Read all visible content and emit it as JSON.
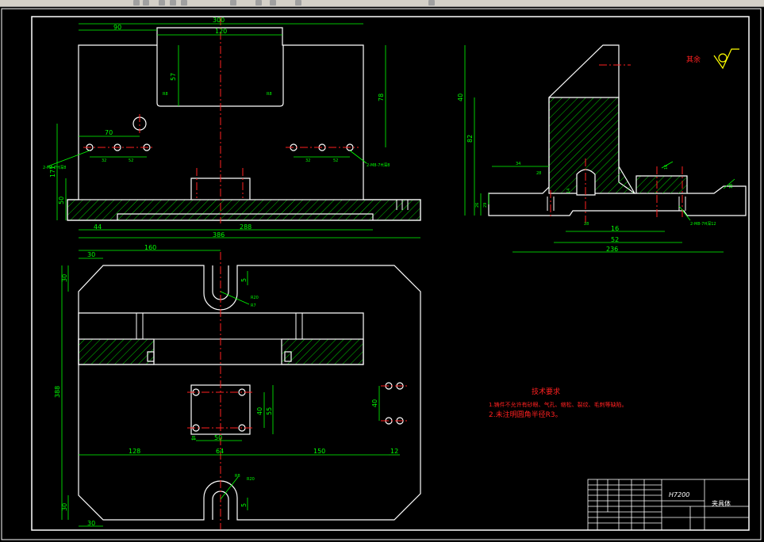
{
  "colors": {
    "background": "#000000",
    "outline": "#ffffff",
    "dimension": "#00ff00",
    "center_line": "#ff2020",
    "hatch": "#00cc00",
    "toolbar": "#d4d0c8"
  },
  "front_view": {
    "dims": {
      "total_top": "300",
      "left_90": "90",
      "slot_120": "120",
      "h57": "57",
      "r_left": "R8",
      "r_right": "R8",
      "v_right": "78",
      "d70": "70",
      "d32a": "32",
      "d52a": "52",
      "d32b": "32",
      "d52b": "52",
      "thread_left": "2-M8-7H深8",
      "thread_right": "2-M8-7H深8",
      "v171": "171",
      "v50": "50",
      "b44": "44",
      "b288": "288",
      "b386": "386"
    }
  },
  "side_view": {
    "dims": {
      "v_left": "40",
      "v_mid": "82",
      "d34": "34",
      "d28": "28",
      "d14": "14",
      "d26": "26",
      "d29": "29",
      "d28b": "28",
      "d16": "16",
      "d16r": "16",
      "d18r": "18",
      "d52": "52",
      "d236": "236",
      "thread": "2-M8-7H深12"
    }
  },
  "top_view": {
    "dims": {
      "t30": "30",
      "t160": "160",
      "v30a": "30",
      "v388": "388",
      "v30b": "30",
      "b30": "30",
      "s5a": "5",
      "r20a": "R20",
      "r7a": "R7",
      "r8b": "R8",
      "r20b": "R20",
      "s5b": "5",
      "h40": "40",
      "h55": "55",
      "w50": "50",
      "w18": "18",
      "w128": "128",
      "w64": "64",
      "w150": "150",
      "w12": "12",
      "v40r": "40"
    }
  },
  "roughness": {
    "label": "其余"
  },
  "tech_notes": {
    "title": "技术要求",
    "line1": "1.铸件不允许有砂眼、气孔、缩松、裂纹、毛刺等缺陷。",
    "line2": "2.未注明圆角半径R3。"
  },
  "title_block": {
    "model": "H7200",
    "part_name": "夹具体"
  }
}
